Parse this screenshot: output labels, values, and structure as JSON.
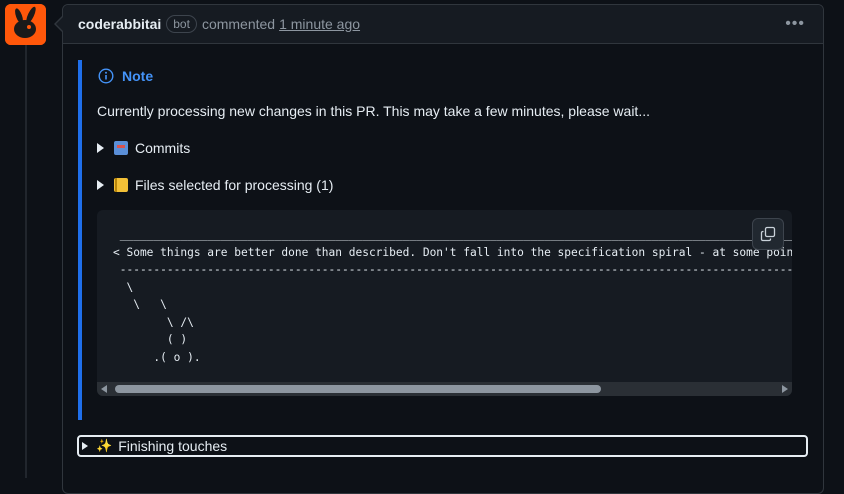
{
  "comment": {
    "author": "coderabbitai",
    "badge": "bot",
    "verb": "commented",
    "timestamp": "1 minute ago",
    "menu_icon": "kebab-horizontal-icon"
  },
  "note": {
    "title": "Note",
    "text": "Currently processing new changes in this PR. This may take a few minutes, please wait...",
    "details": [
      {
        "label": "Commits",
        "icon": "robot-emoji-icon"
      },
      {
        "label": "Files selected for processing (1)",
        "icon": "ledger-emoji-icon"
      }
    ]
  },
  "code": {
    "content": " ____________________________________________________________________________________________________\n< Some things are better done than described. Don't fall into the specification spiral - at some point >\n ----------------------------------------------------------------------------------------------------\n  \\\n   \\   \\\n        \\ /\\\n        ( )\n      .( o ).",
    "copy_icon": "copy-icon"
  },
  "finishing": {
    "label": "Finishing touches",
    "icon": "sparkles-emoji-icon"
  },
  "colors": {
    "accent": "#4493f8",
    "note_border": "#1f6feb",
    "avatar_bg": "#ff570a"
  }
}
